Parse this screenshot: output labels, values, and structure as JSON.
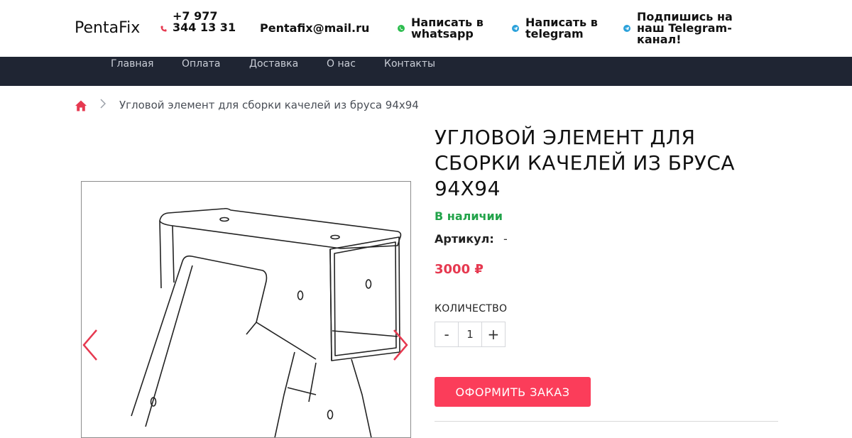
{
  "header": {
    "logo": "PentaFix",
    "phone": "+7 977 344 13 31",
    "email": "Pentafix@mail.ru",
    "whatsapp": "Написать в whatsapp",
    "telegram": "Написать в telegram",
    "subscribe": "Подпишись на наш Telegram-канал!"
  },
  "nav": [
    "Главная",
    "Оплата",
    "Доставка",
    "О нас",
    "Контакты"
  ],
  "breadcrumb": {
    "current": "Угловой элемент для сборки качелей из бруса 94х94"
  },
  "product": {
    "title": "УГЛОВОЙ ЭЛЕМЕНТ ДЛЯ СБОРКИ КАЧЕЛЕЙ ИЗ БРУСА 94Х94",
    "stock": "В наличии",
    "sku_label": "Артикул:",
    "sku_value": "-",
    "price": "3000 ₽",
    "qty_label": "КОЛИЧЕСТВО",
    "qty_minus": "-",
    "qty_value": "1",
    "qty_plus": "+",
    "order_button": "ОФОРМИТЬ ЗАКАЗ"
  },
  "colors": {
    "accent": "#fb3d5a",
    "nav_bg": "#1f2533",
    "stock": "#22a34a",
    "whatsapp": "#2dbd4f",
    "telegram": "#2aa1da"
  },
  "icons": {
    "phone": "phone-icon",
    "whatsapp": "whatsapp-icon",
    "telegram": "telegram-icon",
    "home": "home-icon",
    "breadcrumb_separator": "chevron-right-icon",
    "gallery_prev": "chevron-left-icon",
    "gallery_next": "chevron-right-icon"
  }
}
